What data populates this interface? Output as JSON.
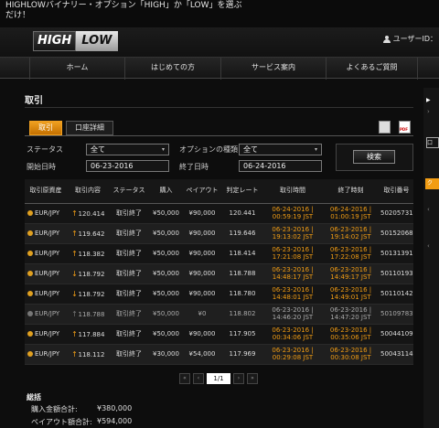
{
  "banner": {
    "line1": "HIGHLOWバイナリー・オプション「HIGH」か「LOW」を選ぶ",
    "line2": "だけ！"
  },
  "logo": {
    "high": "HIGH",
    "low": "LOW"
  },
  "user": {
    "label": "ユーザーID："
  },
  "nav": {
    "items": [
      "ホーム",
      "はじめての方",
      "サービス案内",
      "よくあるご質問"
    ]
  },
  "page": {
    "title": "取引"
  },
  "tabs": [
    "取引",
    "口座詳細"
  ],
  "form": {
    "status_label": "ステータス",
    "status_value": "全て",
    "option_type_label": "オプションの種類",
    "option_type_value": "全て",
    "start_label": "開始日時",
    "start_value": "06-23-2016",
    "end_label": "終了日時",
    "end_value": "06-24-2016",
    "search_label": "検索"
  },
  "table": {
    "headers": [
      "取引原資産",
      "取引内容",
      "ステータス",
      "購入",
      "ペイアウト",
      "判定レート",
      "取引時間",
      "終了時刻",
      "取引番号"
    ],
    "rows": [
      {
        "asset": "EUR/JPY",
        "dir": "up",
        "rate": "120.414",
        "status": "取引終了",
        "buy": "¥50,000",
        "payout": "¥90,000",
        "judge": "120.441",
        "t_date": "06-24-2016 |",
        "t_time": "00:59:19 JST",
        "e_date": "06-24-2016 |",
        "e_time": "01:00:19 JST",
        "id": "50205731",
        "grey": false
      },
      {
        "asset": "EUR/JPY",
        "dir": "up",
        "rate": "119.642",
        "status": "取引終了",
        "buy": "¥50,000",
        "payout": "¥90,000",
        "judge": "119.646",
        "t_date": "06-23-2016 |",
        "t_time": "19:13:02 JST",
        "e_date": "06-23-2016 |",
        "e_time": "19:14:02 JST",
        "id": "50152068",
        "grey": false
      },
      {
        "asset": "EUR/JPY",
        "dir": "up",
        "rate": "118.382",
        "status": "取引終了",
        "buy": "¥50,000",
        "payout": "¥90,000",
        "judge": "118.414",
        "t_date": "06-23-2016 |",
        "t_time": "17:21:08 JST",
        "e_date": "06-23-2016 |",
        "e_time": "17:22:08 JST",
        "id": "50131391",
        "grey": false
      },
      {
        "asset": "EUR/JPY",
        "dir": "down",
        "rate": "118.792",
        "status": "取引終了",
        "buy": "¥50,000",
        "payout": "¥90,000",
        "judge": "118.788",
        "t_date": "06-23-2016 |",
        "t_time": "14:48:17 JST",
        "e_date": "06-23-2016 |",
        "e_time": "14:49:17 JST",
        "id": "50110193",
        "grey": false
      },
      {
        "asset": "EUR/JPY",
        "dir": "down",
        "rate": "118.792",
        "status": "取引終了",
        "buy": "¥50,000",
        "payout": "¥90,000",
        "judge": "118.780",
        "t_date": "06-23-2016 |",
        "t_time": "14:48:01 JST",
        "e_date": "06-23-2016 |",
        "e_time": "14:49:01 JST",
        "id": "50110142",
        "grey": false
      },
      {
        "asset": "EUR/JPY",
        "dir": "none",
        "rate": "118.788",
        "status": "取引終了",
        "buy": "¥50,000",
        "payout": "¥0",
        "judge": "118.802",
        "t_date": "06-23-2016 |",
        "t_time": "14:46:20 JST",
        "e_date": "06-23-2016 |",
        "e_time": "14:47:20 JST",
        "id": "50109783",
        "grey": true
      },
      {
        "asset": "EUR/JPY",
        "dir": "up",
        "rate": "117.884",
        "status": "取引終了",
        "buy": "¥50,000",
        "payout": "¥90,000",
        "judge": "117.905",
        "t_date": "06-23-2016 |",
        "t_time": "00:34:06 JST",
        "e_date": "06-23-2016 |",
        "e_time": "00:35:06 JST",
        "id": "50044109",
        "grey": false
      },
      {
        "asset": "EUR/JPY",
        "dir": "up",
        "rate": "118.112",
        "status": "取引終了",
        "buy": "¥30,000",
        "payout": "¥54,000",
        "judge": "117.969",
        "t_date": "06-23-2016 |",
        "t_time": "00:29:08 JST",
        "e_date": "06-23-2016 |",
        "e_time": "00:30:08 JST",
        "id": "50043114",
        "grey": false
      }
    ]
  },
  "pager": {
    "current": "1/1"
  },
  "totals": {
    "title": "総括",
    "buy_label": "購入金額合計:",
    "buy_value": "¥380,000",
    "payout_label": "ペイアウト額合計:",
    "payout_value": "¥594,000"
  },
  "side": {
    "box_label": "口",
    "orange_label": "ク"
  }
}
